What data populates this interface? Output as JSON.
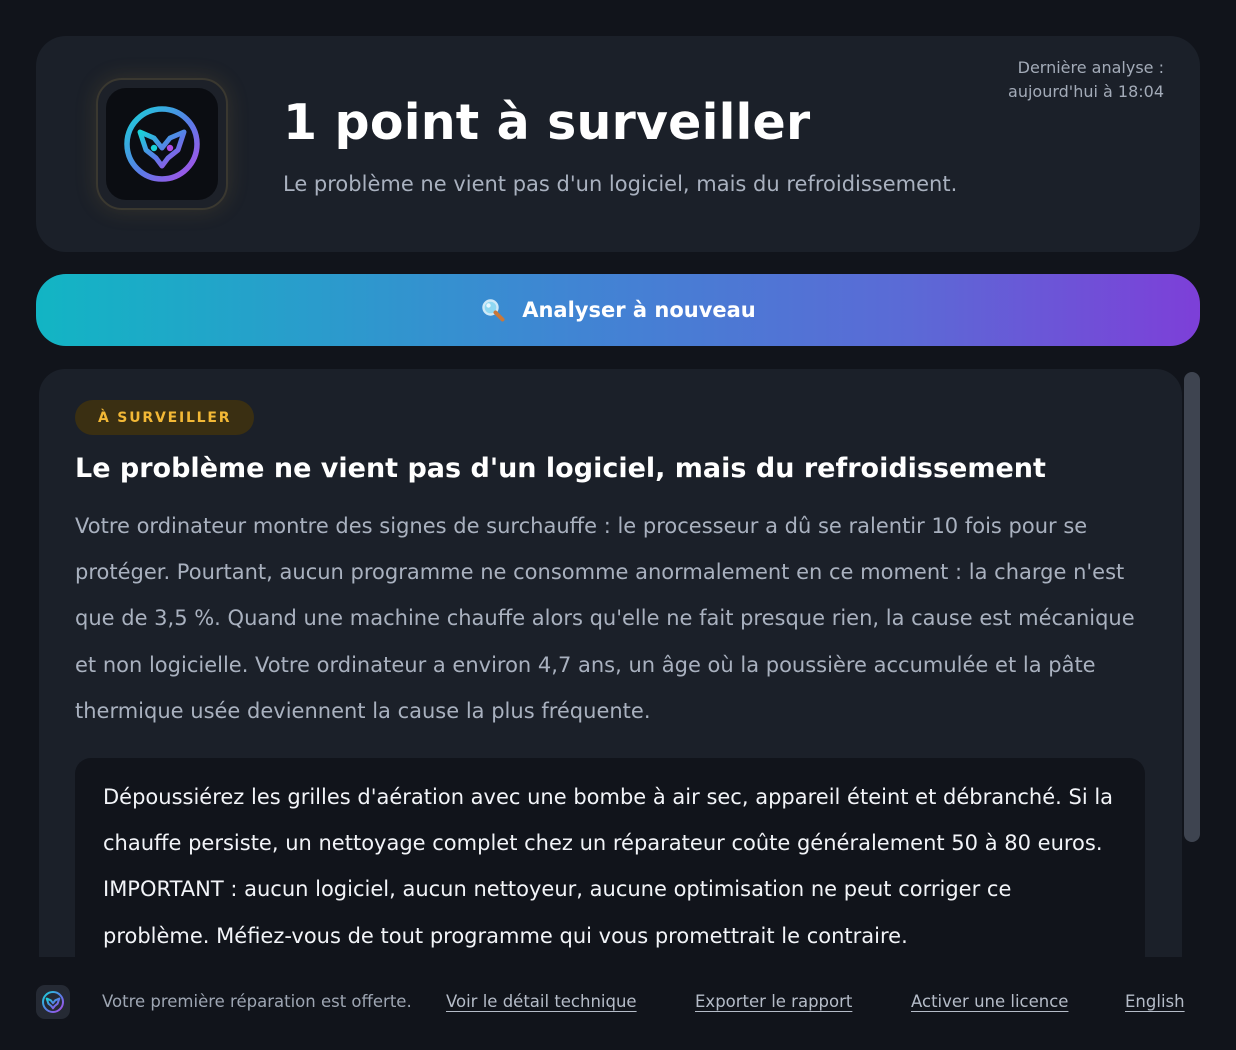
{
  "header": {
    "logo_icon": "owl-logo-icon",
    "title": "1 point à surveiller",
    "subtitle": "Le problème ne vient pas d'un logiciel, mais du refroidissement.",
    "last_analysis_label": "Dernière analyse :",
    "last_analysis_value": "aujourd'hui à 18:04"
  },
  "rescan": {
    "icon": "magnifier-icon",
    "label": "Analyser à nouveau"
  },
  "finding": {
    "badge": "À SURVEILLER",
    "badge_color": "#f2b836",
    "title": "Le problème ne vient pas d'un logiciel, mais du refroidissement",
    "body": "Votre ordinateur montre des signes de surchauffe : le processeur a dû se ralentir 10 fois pour se protéger. Pourtant, aucun programme ne consomme anormalement en ce moment : la charge n'est que de 3,5 %. Quand une machine chauffe alors qu'elle ne fait presque rien, la cause est mécanique et non logicielle. Votre ordinateur a environ 4,7 ans, un âge où la poussière accumulée et la pâte thermique usée deviennent la cause la plus fréquente.",
    "recommendation": "Dépoussiérez les grilles d'aération avec une bombe à air sec, appareil éteint et débranché. Si la chauffe persiste, un nettoyage complet chez un réparateur coûte généralement 50 à 80 euros. IMPORTANT : aucun logiciel, aucun nettoyeur, aucune optimisation ne peut corriger ce problème. Méfiez-vous de tout programme qui vous promettrait le contraire."
  },
  "footer": {
    "logo_icon": "owl-logo-icon",
    "promo": "Votre première réparation est offerte.",
    "links": {
      "technical_details": "Voir le détail technique",
      "export_report": "Exporter le rapport",
      "activate_license": "Activer une licence",
      "language": "English"
    }
  },
  "colors": {
    "background": "#11141b",
    "card": "#1b2029",
    "gradient_start": "#12b5c4",
    "gradient_end": "#7d3fd8",
    "warning": "#f2b836"
  }
}
